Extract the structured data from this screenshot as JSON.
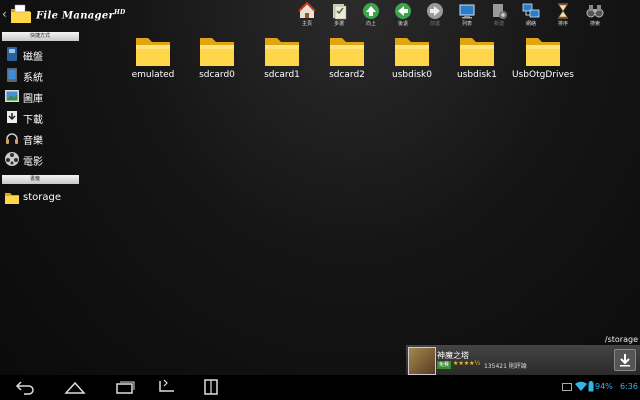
{
  "app": {
    "title": "File Manager",
    "version_mark": "HD"
  },
  "toolbar": [
    {
      "id": "home",
      "label": "主頁",
      "icon": "home-icon",
      "enabled": true
    },
    {
      "id": "multi",
      "label": "多選",
      "icon": "multi-select-icon",
      "enabled": true
    },
    {
      "id": "up",
      "label": "向上",
      "icon": "arrow-up-icon",
      "enabled": true
    },
    {
      "id": "back",
      "label": "後退",
      "icon": "arrow-back-icon",
      "enabled": true
    },
    {
      "id": "forward",
      "label": "前進",
      "icon": "arrow-forward-icon",
      "enabled": false
    },
    {
      "id": "view",
      "label": "列表",
      "icon": "list-view-icon",
      "enabled": true
    },
    {
      "id": "new",
      "label": "新建",
      "icon": "new-folder-icon",
      "enabled": false
    },
    {
      "id": "network",
      "label": "網絡",
      "icon": "network-icon",
      "enabled": true
    },
    {
      "id": "sort",
      "label": "排序",
      "icon": "sort-icon",
      "enabled": true
    },
    {
      "id": "search",
      "label": "搜索",
      "icon": "binoculars-icon",
      "enabled": true
    }
  ],
  "sidebar": {
    "shortcuts_header": "快捷方式",
    "shortcuts": [
      {
        "label": "磁盤",
        "icon": "disk-icon"
      },
      {
        "label": "系統",
        "icon": "phone-icon"
      },
      {
        "label": "圖庫",
        "icon": "gallery-icon"
      },
      {
        "label": "下載",
        "icon": "download-icon"
      },
      {
        "label": "音樂",
        "icon": "music-icon"
      },
      {
        "label": "電影",
        "icon": "film-icon"
      }
    ],
    "bookmarks_header": "書籤",
    "bookmarks": [
      {
        "label": "storage",
        "icon": "folder-icon"
      }
    ]
  },
  "folders": [
    "emulated",
    "sdcard0",
    "sdcard1",
    "sdcard2",
    "usbdisk0",
    "usbdisk1",
    "UsbOtgDrives"
  ],
  "current_path": "/storage",
  "ad": {
    "title": "神魔之塔",
    "free_badge": "免費",
    "stars": "★★★★½",
    "reviews": "135421 則評論"
  },
  "status": {
    "battery": "94%",
    "time": "6:36"
  },
  "colors": {
    "folder_yellow": "#f7c720",
    "status_blue": "#37b4e5"
  }
}
